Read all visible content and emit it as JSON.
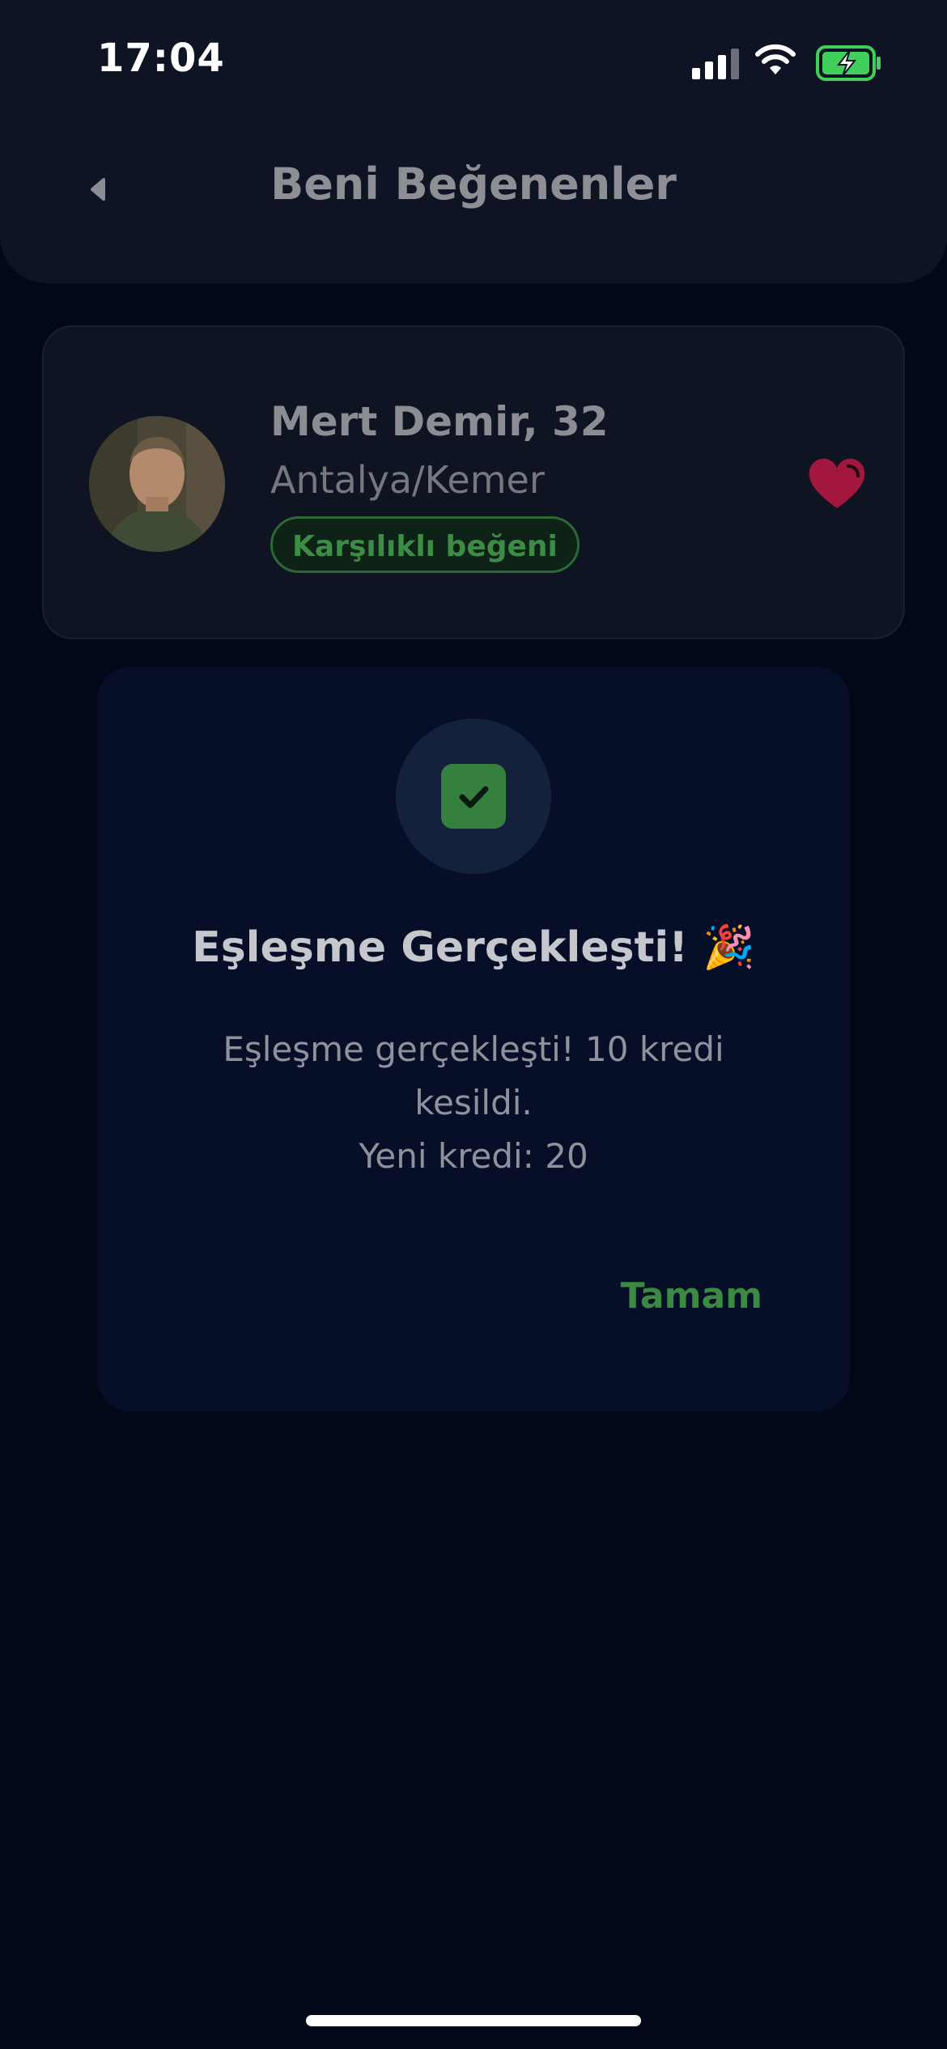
{
  "status_bar": {
    "time": "17:04"
  },
  "header": {
    "title": "Beni Beğenenler"
  },
  "profile": {
    "name": "Mert Demir, 32",
    "location": "Antalya/Kemer",
    "badge": "Karşılıklı beğeni"
  },
  "dialog": {
    "title": "Eşleşme Gerçekleşti! 🎉",
    "message_line1": "Eşleşme gerçekleşti! 10 kredi kesildi.",
    "message_line2": "Yeni kredi: 20",
    "ok_label": "Tamam"
  },
  "colors": {
    "background": "#030818",
    "accent_green": "#3a8a43",
    "heart_red": "#a3173f"
  },
  "icons": [
    "signal-icon",
    "wifi-icon",
    "battery-charging-icon",
    "back-arrow-icon",
    "heart-icon",
    "check-icon"
  ]
}
